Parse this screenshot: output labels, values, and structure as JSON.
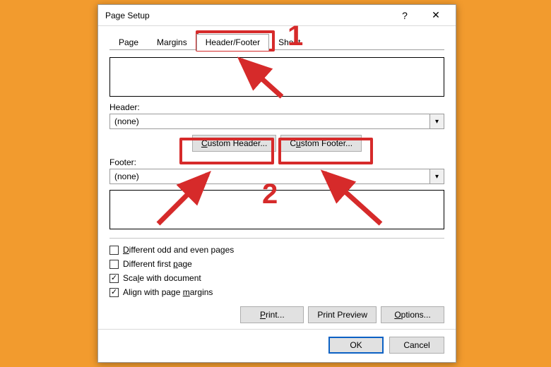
{
  "dialog": {
    "title": "Page Setup"
  },
  "tabs": {
    "page": "Page",
    "margins": "Margins",
    "header_footer": "Header/Footer",
    "sheet": "Sheet"
  },
  "sections": {
    "header_label": "Header:",
    "footer_label": "Footer:"
  },
  "dropdowns": {
    "header_value": "(none)",
    "footer_value": "(none)"
  },
  "buttons": {
    "custom_header": "Custom Header...",
    "custom_footer": "Custom Footer...",
    "print": "Print...",
    "print_preview": "Print Preview",
    "options": "Options...",
    "ok": "OK",
    "cancel": "Cancel"
  },
  "checkboxes": {
    "diff_odd_even": {
      "label_pre": "D",
      "label_rest": "ifferent odd and even pages",
      "checked": false
    },
    "diff_first": {
      "label_pre": "Di",
      "label_rest": "fferent first page",
      "checked": false
    },
    "scale_doc": {
      "label_pre": "Sca",
      "label_rest": "le with document",
      "checked": true
    },
    "align_margins": {
      "label_pre": "Align with page ",
      "label_rest": "margins",
      "checked": true
    }
  },
  "annotations": {
    "num1": "1",
    "num2": "2"
  }
}
